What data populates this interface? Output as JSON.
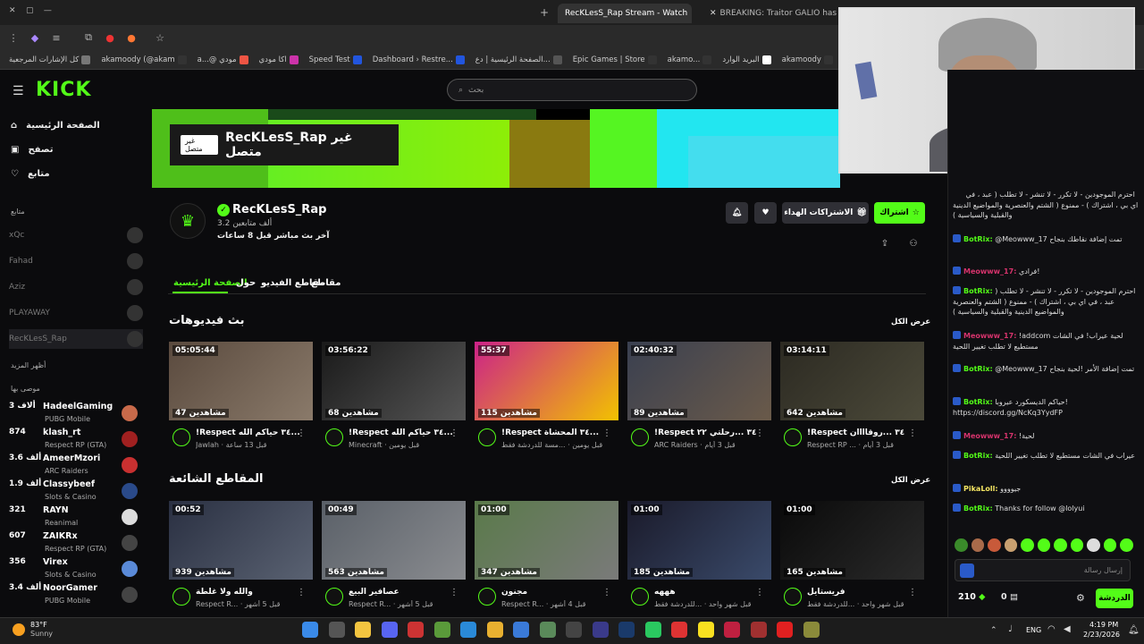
{
  "browser": {
    "tabs": [
      {
        "label": "RecKLesS_Rap Stream - Watch",
        "active": true
      },
      {
        "label": "BREAKING: Traitor GALIO has",
        "active": false
      }
    ],
    "bookmarks": [
      {
        "label": "كل الإشارات المرجعية",
        "color": "#777"
      },
      {
        "label": "akamoody (@akam",
        "color": "#333"
      },
      {
        "label": "a...@ مودي",
        "color": "#e54"
      },
      {
        "label": "اكا مودي",
        "color": "#c3a"
      },
      {
        "label": "Speed Test",
        "color": "#2255dd"
      },
      {
        "label": "Dashboard › Restre...",
        "color": "#2255dd"
      },
      {
        "label": "الصفحة الرئيسية | دع...",
        "color": "#555"
      },
      {
        "label": "Epic Games | Store",
        "color": "#333"
      },
      {
        "label": "akamo...",
        "color": "#333"
      },
      {
        "label": "البريد الوارد",
        "color": "#fff"
      },
      {
        "label": "akamoody",
        "color": "#333"
      }
    ]
  },
  "kick": {
    "logo": "KICK",
    "search_placeholder": "بحث",
    "nav": [
      {
        "label": "الصفحة الرئيسية",
        "icon": "home-icon"
      },
      {
        "label": "تصفح",
        "icon": "browse-icon"
      },
      {
        "label": "متابع",
        "icon": "heart-icon"
      }
    ],
    "following_title": "متابع",
    "following": [
      {
        "name": "xQc"
      },
      {
        "name": "Fahad"
      },
      {
        "name": "Aziz"
      },
      {
        "name": "PLAYAWAY"
      },
      {
        "name": "RecKLesS_Rap"
      }
    ],
    "show_more": "أظهر المزيد",
    "recommended_title": "موصى بها",
    "recommended": [
      {
        "name": "HadeelGaming",
        "count": "3 ألاف",
        "category": "PUBG Mobile"
      },
      {
        "name": "klash_rt",
        "count": "874",
        "category": "Respect RP (GTA)"
      },
      {
        "name": "AmeerMzori",
        "count": "3.6 ألف",
        "category": "ARC Raiders"
      },
      {
        "name": "Classybeef",
        "count": "1.9 ألف",
        "category": "Slots & Casino"
      },
      {
        "name": "RAYN",
        "count": "321",
        "category": "Reanimal"
      },
      {
        "name": "ZAIKRx",
        "count": "607",
        "category": "Respect RP (GTA)"
      },
      {
        "name": "Virex",
        "count": "356",
        "category": "Slots & Casino"
      },
      {
        "name": "NoorGamer",
        "count": "3.4 ألف",
        "category": "PUBG Mobile"
      }
    ]
  },
  "banner": {
    "offline_badge": "غير متصل",
    "title": "RecKLesS_Rap غير متصل"
  },
  "channel": {
    "name": "RecKLesS_Rap",
    "followers": "3.2 ألف متابعين",
    "last_live": "آخر بث مباشر قبل 8 ساعات",
    "subscribe": "اشتراك",
    "gift": "الاشتراكات الهداء",
    "tabs": [
      "الصفحة الرئيسية",
      "حول",
      "مقاطع الفيديو",
      "مقاطع"
    ]
  },
  "sections": {
    "videos_title": "بث فيديوهات",
    "clips_title": "المقاطع الشائعة",
    "see_all": "عرض الكل"
  },
  "videos": [
    {
      "duration": "05:05:44",
      "views": "47 مشاهدين",
      "title": "!Respect ٣٤ حياكم الله...",
      "sub": "Jawlah · قبل 13 ساعة",
      "colors": [
        "#5a4a3e",
        "#8a7a6a"
      ]
    },
    {
      "duration": "03:56:22",
      "views": "68 مشاهدين",
      "title": "!Respect ٣٤ حياكم الله...",
      "sub": "Minecraft · قبل يومين",
      "colors": [
        "#1a1a1a",
        "#555"
      ]
    },
    {
      "duration": "55:37",
      "views": "115 مشاهدين",
      "title": "!Respect ٣٤ المحشاة...",
      "sub": "قبل يومين · ...مسة للدردشة فقط",
      "colors": [
        "#cc2288",
        "#f2c200"
      ]
    },
    {
      "duration": "02:40:32",
      "views": "89 مشاهدين",
      "title": "!Respect ٣٤ ...رحلتي ٢٢",
      "sub": "ARC Raiders · قبل 3 أيام",
      "colors": [
        "#3a4050",
        "#6a5a4a"
      ]
    },
    {
      "duration": "03:14:11",
      "views": "642 مشاهدين",
      "title": "!Respect ٣٤ ...روقاااان",
      "sub": "Respect RP ... · قبل 3 أيام",
      "colors": [
        "#2c2a22",
        "#4c4a3a"
      ]
    }
  ],
  "clips": [
    {
      "duration": "00:52",
      "views": "939 مشاهدين",
      "title": "والله ولا غلطة",
      "sub": "Respect R... · قبل 5 أشهر",
      "colors": [
        "#2a3042",
        "#5a6272"
      ]
    },
    {
      "duration": "00:49",
      "views": "563 مشاهدين",
      "title": "عصافير البيع",
      "sub": "Respect R... · قبل 5 أشهر",
      "colors": [
        "#5a6068",
        "#8a8c90"
      ]
    },
    {
      "duration": "01:00",
      "views": "347 مشاهدين",
      "title": "مجنون",
      "sub": "Respect R... · قبل 4 أشهر",
      "colors": [
        "#5a7a4a",
        "#7a7a7a"
      ]
    },
    {
      "duration": "01:00",
      "views": "185 مشاهدين",
      "title": "هههه",
      "sub": "قبل شهر واحد · ...للدردشة فقط",
      "colors": [
        "#1a1a2a",
        "#3a4a6a"
      ]
    },
    {
      "duration": "01:00",
      "views": "165 مشاهدين",
      "title": "فريستايل",
      "sub": "قبل شهر واحد · ...للدردشة فقط",
      "colors": [
        "#0a0a0a",
        "#2a2a2a"
      ]
    }
  ],
  "chat": {
    "messages": [
      {
        "user": "",
        "text": "احترم الموجودين - لا تكرر - لا تنشر - لا تطلب ( عبد ، في اي بي ، اشتراك ) - ممنوع ( الشتم والعنصرية والمواضيع الدينية والقبلية والسياسية )",
        "color": "#53fc18"
      },
      {
        "user": "BotRix:",
        "text": "@Meowww_17 تمت إضافة نقاطك بنجاح",
        "color": "#53fc18"
      },
      {
        "user": "Meowww_17:",
        "text": "فرادي!",
        "color": "#d6336c"
      },
      {
        "user": "BotRix:",
        "text": "احترم الموجودين - لا تكرر - لا تنشر - لا تطلب ( عبد ، في اي بي ، اشتراك ) - ممنوع ( الشتم والعنصرية والمواضيع الدينية والقبلية والسياسية )",
        "color": "#53fc18"
      },
      {
        "user": "Meowww_17:",
        "text": "!addcom لحية عيراب! في الشات مستطيع لا تطلب تغيير اللحية",
        "color": "#d6336c"
      },
      {
        "user": "BotRix:",
        "text": "@Meowww_17 تمت إضافة الأمر !لحية بنجاح",
        "color": "#53fc18"
      },
      {
        "user": "BotRix:",
        "text": "حياكم الديسكورد عيروبا! https://discord.gg/NcKq3YydFP",
        "color": "#53fc18"
      },
      {
        "user": "Meowww_17:",
        "text": "!لحية",
        "color": "#d6336c"
      },
      {
        "user": "BotRix:",
        "text": "عيراب في الشات مستطيع لا تطلب تغيير اللحية",
        "color": "#53fc18"
      },
      {
        "user": "PikaLoll:",
        "text": "جيوووو",
        "color": "#f5e663"
      },
      {
        "user": "BotRix:",
        "text": "Thanks for follow @lolyui",
        "color": "#53fc18"
      }
    ],
    "input_placeholder": "إرسال رسالة",
    "points": "210",
    "count": "0",
    "send": "الدردشة"
  },
  "taskbar": {
    "temp": "83°F",
    "weather": "Sunny",
    "lang": "ENG",
    "time": "4:19 PM",
    "date": "2/23/2026"
  },
  "colors": {
    "brand": "#53fc18",
    "bg": "#0b0b0d"
  }
}
